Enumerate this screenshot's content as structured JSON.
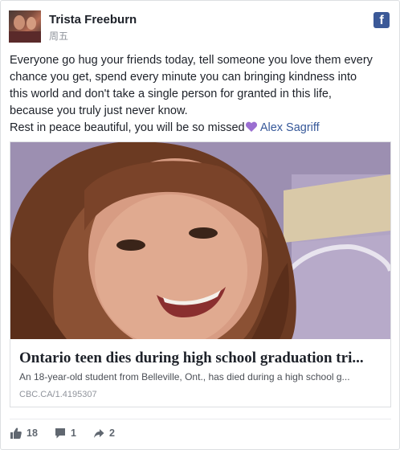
{
  "post": {
    "author": "Trista Freeburn",
    "timestamp": "周五",
    "brand_icon": "facebook-icon",
    "brand_color": "#3b5998",
    "text_lines": [
      "Everyone go hug your friends today, tell someone you love them every",
      "chance you get, spend every minute you can bringing kindness into",
      "this world and don't take a single person for granted in this life,",
      "because you truly just never know."
    ],
    "closing": "Rest in peace beautiful, you will be so missed",
    "closing_emoji": "purple-heart-icon",
    "mention": "Alex Sagriff",
    "mention_color": "#365899"
  },
  "link_card": {
    "image": "portrait-photo",
    "title": "Ontario teen dies during high school graduation tri...",
    "description": "An 18-year-old student from Belleville, Ont., has died during a high school g...",
    "source": "CBC.CA/1.4195307"
  },
  "footer": {
    "likes": "18",
    "comments": "1",
    "shares": "2",
    "like_icon": "thumbs-up-icon",
    "comment_icon": "comment-icon",
    "share_icon": "share-arrow-icon"
  }
}
